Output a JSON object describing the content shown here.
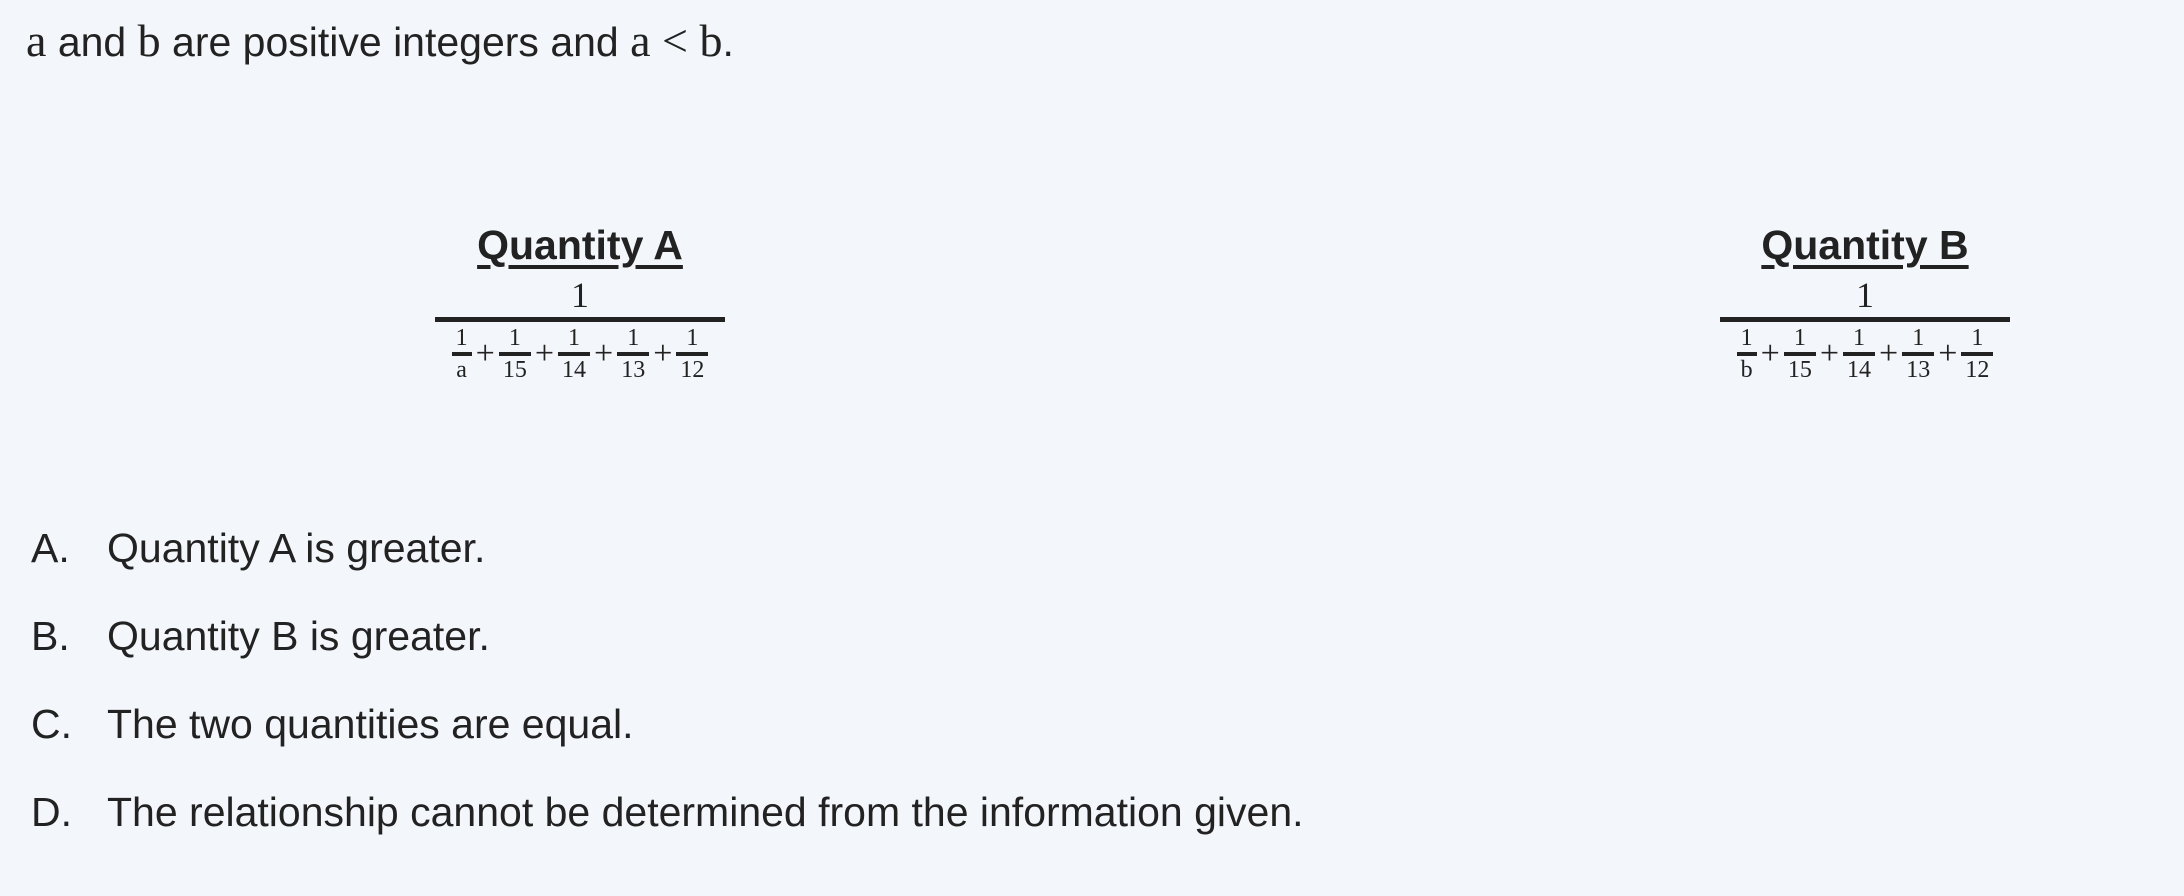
{
  "stem": {
    "v1": "a",
    "t1": " and ",
    "v2": "b",
    "t2": " are positive integers and ",
    "v3": "a",
    "lt": " < ",
    "v4": "b",
    "end": "."
  },
  "quantity_a": {
    "title": "Quantity A",
    "numerator": "1",
    "terms": [
      {
        "n": "1",
        "d": "a"
      },
      {
        "n": "1",
        "d": "15"
      },
      {
        "n": "1",
        "d": "14"
      },
      {
        "n": "1",
        "d": "13"
      },
      {
        "n": "1",
        "d": "12"
      }
    ]
  },
  "quantity_b": {
    "title": "Quantity B",
    "numerator": "1",
    "terms": [
      {
        "n": "1",
        "d": "b"
      },
      {
        "n": "1",
        "d": "15"
      },
      {
        "n": "1",
        "d": "14"
      },
      {
        "n": "1",
        "d": "13"
      },
      {
        "n": "1",
        "d": "12"
      }
    ]
  },
  "plus": "+",
  "options": [
    {
      "letter": "A.",
      "text": "Quantity A is greater."
    },
    {
      "letter": "B.",
      "text": "Quantity B is greater."
    },
    {
      "letter": "C.",
      "text": "The two quantities are equal."
    },
    {
      "letter": "D.",
      "text": "The relationship cannot be determined from the information given."
    }
  ]
}
